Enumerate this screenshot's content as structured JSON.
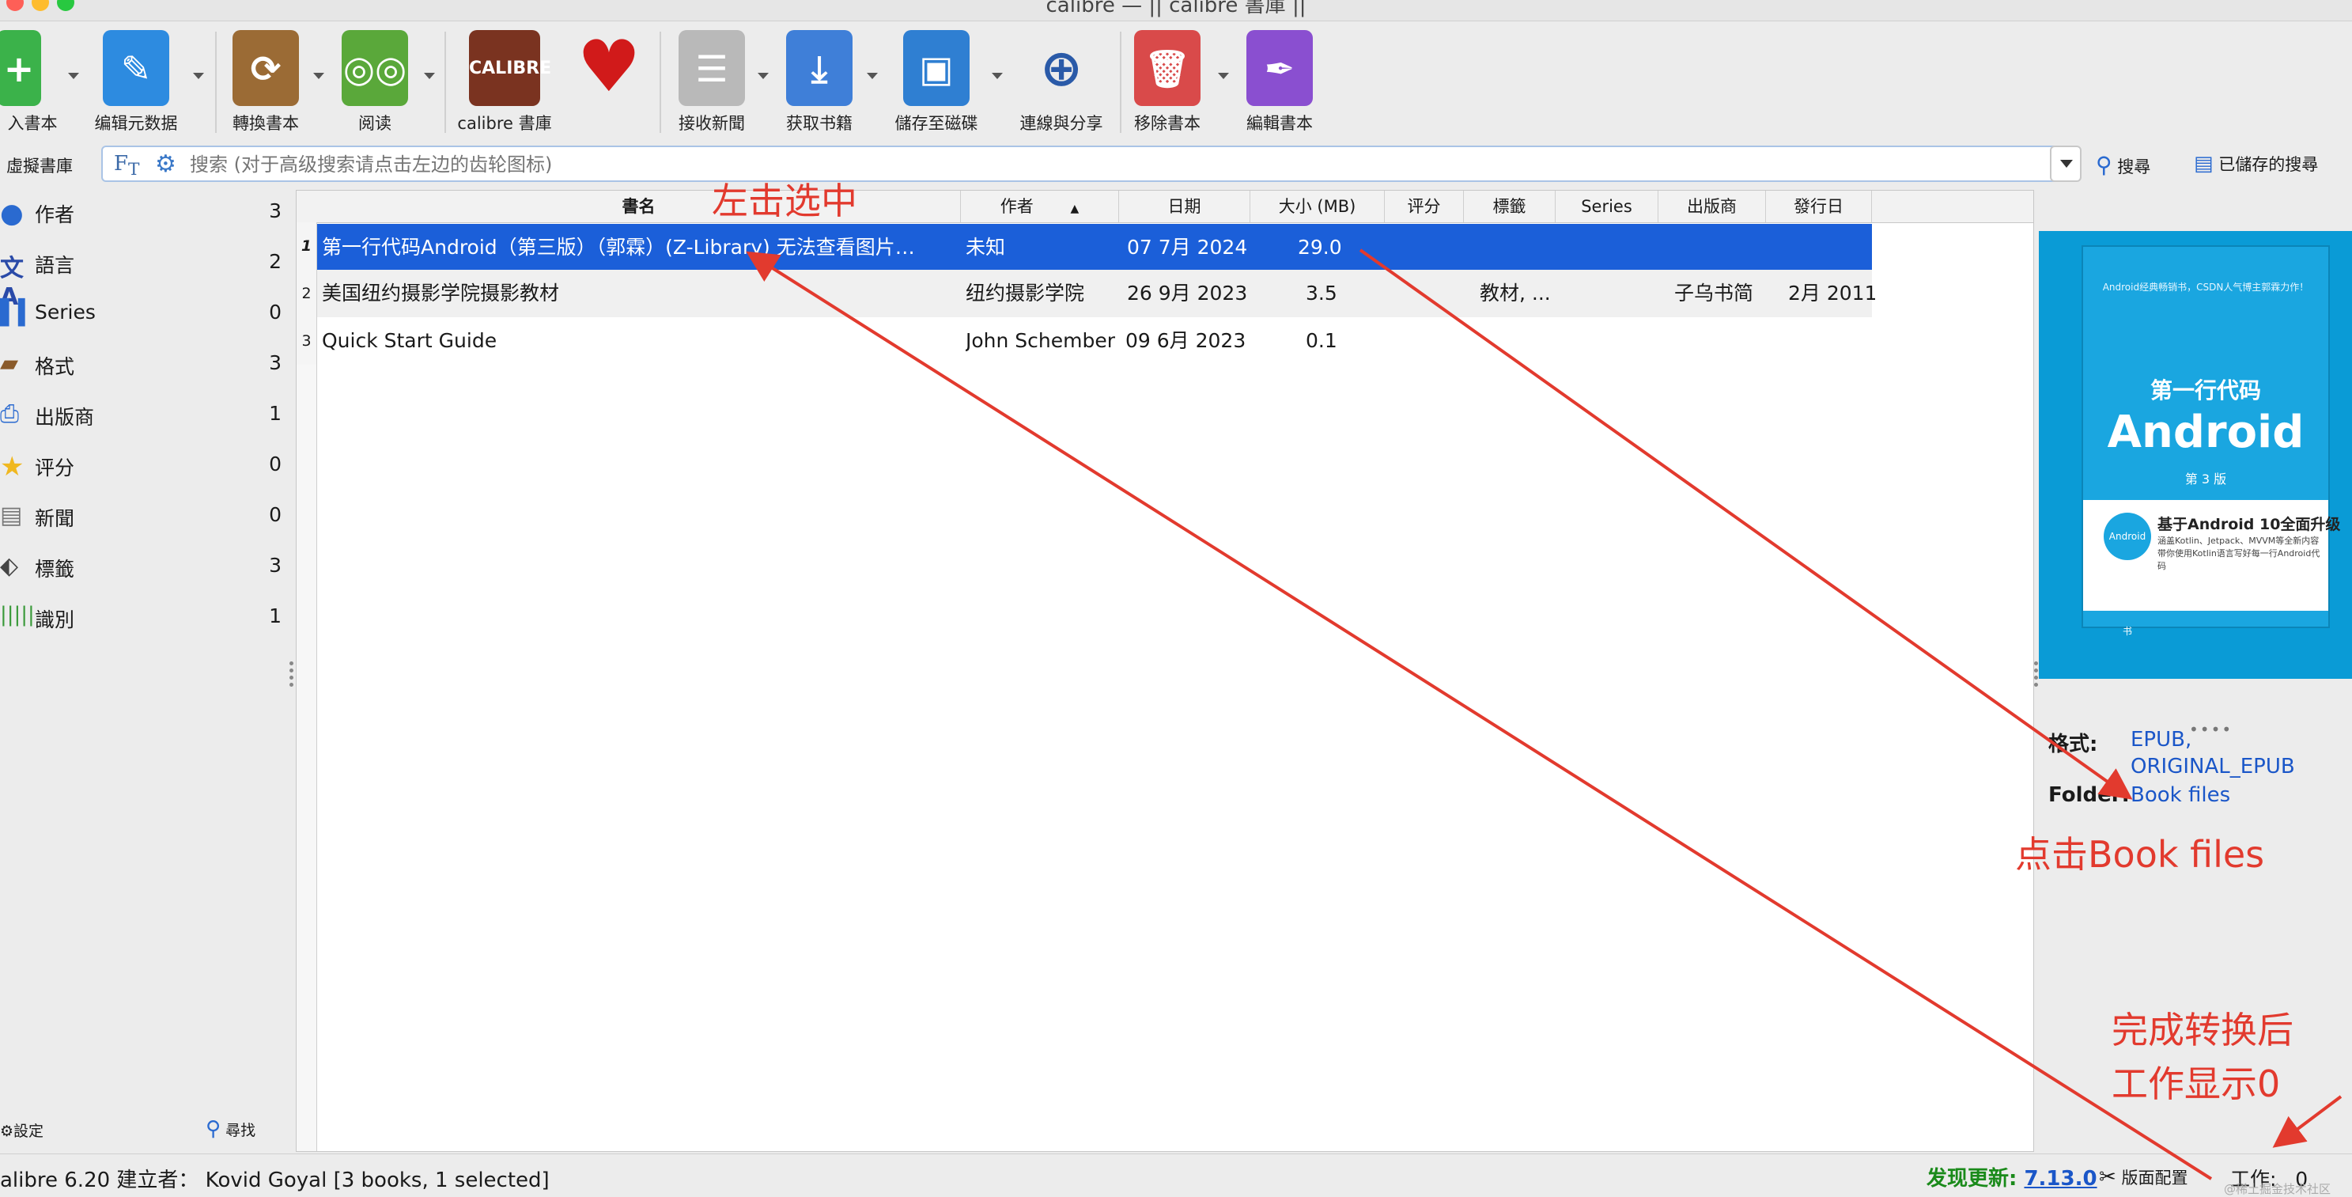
{
  "window": {
    "title": "calibre — || calibre 書庫 ||"
  },
  "toolbar": {
    "add_books": "入書本",
    "edit_metadata": "编辑元数据",
    "convert_books": "轉換書本",
    "view": "阅读",
    "library": "calibre 書庫",
    "fetch_news": "接收新聞",
    "get_books": "获取书籍",
    "save_to_disk": "儲存至磁碟",
    "connect_share": "連線與分享",
    "remove_books": "移除書本",
    "edit_book": "編輯書本"
  },
  "search": {
    "virtual_library": "虛擬書庫",
    "placeholder": "搜索 (对于高级搜索请点击左边的齿轮图标)",
    "search_button": "搜尋",
    "saved_searches": "已儲存的搜尋"
  },
  "sidebar": {
    "items": [
      {
        "label": "作者",
        "count": "3",
        "icon": "person-icon"
      },
      {
        "label": "語言",
        "count": "2",
        "icon": "language-icon"
      },
      {
        "label": "Series",
        "count": "0",
        "icon": "series-icon"
      },
      {
        "label": "格式",
        "count": "3",
        "icon": "format-icon"
      },
      {
        "label": "出版商",
        "count": "1",
        "icon": "publisher-icon"
      },
      {
        "label": "评分",
        "count": "0",
        "icon": "star-icon"
      },
      {
        "label": "新聞",
        "count": "0",
        "icon": "news-icon"
      },
      {
        "label": "標籤",
        "count": "3",
        "icon": "tag-icon"
      },
      {
        "label": "識別",
        "count": "1",
        "icon": "barcode-icon"
      }
    ],
    "settings": "設定",
    "find": "尋找"
  },
  "table": {
    "columns": [
      "書名",
      "作者",
      "日期",
      "大小 (MB)",
      "评分",
      "標籤",
      "Series",
      "出版商",
      "發行日"
    ],
    "rows": [
      {
        "num": "1",
        "title": "第一行代码Android（第三版）（郭霖）(Z-Library) 无法查看图片…",
        "author": "未知",
        "date": "07 7月 2024",
        "size": "29.0",
        "rating": "",
        "tags": "",
        "series": "",
        "publisher": "",
        "pubdate": ""
      },
      {
        "num": "2",
        "title": "美国纽约摄影学院摄影教材",
        "author": "纽约摄影学院",
        "date": "26 9月 2023",
        "size": "3.5",
        "rating": "",
        "tags": "教材, ...",
        "series": "",
        "publisher": "子乌书简",
        "pubdate": "2月 2011"
      },
      {
        "num": "3",
        "title": "Quick Start Guide",
        "author": "John Schember",
        "date": "09 6月 2023",
        "size": "0.1",
        "rating": "",
        "tags": "",
        "series": "",
        "publisher": "",
        "pubdate": ""
      }
    ]
  },
  "cover": {
    "promo": "Android经典畅销书，CSDN人气博主郭霖力作！",
    "title_cn": "第一行代码",
    "title_main": "Android",
    "edition": "第 3 版",
    "subtitle": "基于Android 10全面升级",
    "desc": "涵盖Kotlin、Jetpack、MVVM等全新内容 带你使用Kotlin语言写好每一行Android代码",
    "seal": "Android 学习 经典书"
  },
  "details": {
    "formats_label": "格式:",
    "formats": [
      "EPUB,",
      "ORIGINAL_EPUB"
    ],
    "folder_label": "Folder:",
    "folder_value": "Book files"
  },
  "status": {
    "left": "alibre 6.20 建立者：   Kovid Goyal    [3 books, 1 selected]",
    "update_label": "发现更新:",
    "update_version": "7.13.0",
    "layout": "版面配置",
    "jobs_label": "工作:",
    "jobs_count": "0",
    "watermark": "@稀土掘金技术社区"
  },
  "annotations": {
    "select": "左击选中",
    "click_book_files": "点击Book files",
    "done_line1": "完成转换后",
    "done_line2": "工作显示0"
  },
  "colors": {
    "accent": "#1b5fd9",
    "annotation": "#e23a2e",
    "update": "#1a8a1a",
    "link": "#1a56c8"
  }
}
